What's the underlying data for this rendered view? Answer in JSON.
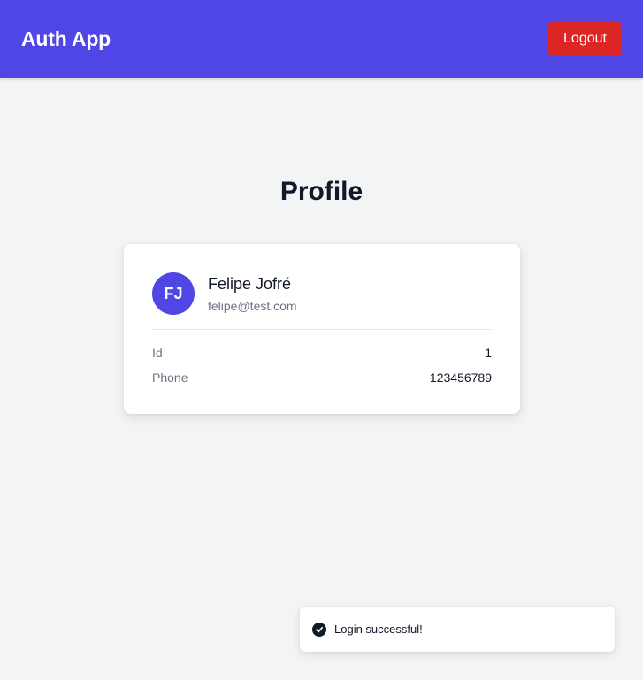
{
  "header": {
    "title": "Auth App",
    "logout_label": "Logout",
    "accent": "#4f46e5",
    "logout_color": "#dc2626"
  },
  "page": {
    "title": "Profile"
  },
  "profile": {
    "initials": "FJ",
    "name": "Felipe Jofré",
    "email": "felipe@test.com",
    "details": [
      {
        "label": "Id",
        "value": "1"
      },
      {
        "label": "Phone",
        "value": "123456789"
      }
    ]
  },
  "toast": {
    "icon": "check-circle-icon",
    "message": "Login successful!"
  }
}
